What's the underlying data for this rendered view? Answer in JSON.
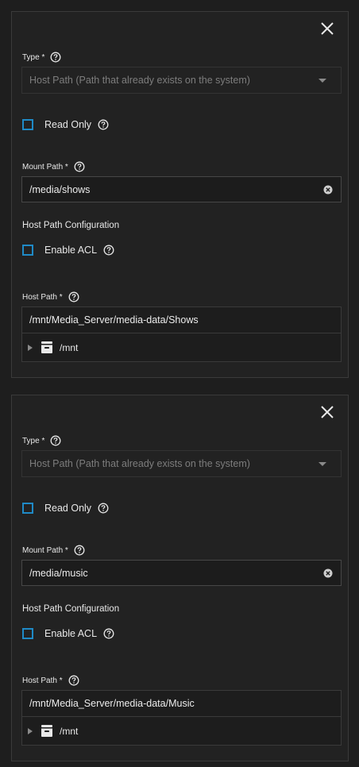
{
  "mounts": [
    {
      "type_label": "Type *",
      "type_value": "Host Path (Path that already exists on the system)",
      "read_only_label": "Read Only",
      "mount_path_label": "Mount Path *",
      "mount_path_value": "/media/shows",
      "host_path_config_title": "Host Path Configuration",
      "enable_acl_label": "Enable ACL",
      "host_path_label": "Host Path *",
      "host_path_value": "/mnt/Media_Server/media-data/Shows",
      "tree_root": "/mnt"
    },
    {
      "type_label": "Type *",
      "type_value": "Host Path (Path that already exists on the system)",
      "read_only_label": "Read Only",
      "mount_path_label": "Mount Path *",
      "mount_path_value": "/media/music",
      "host_path_config_title": "Host Path Configuration",
      "enable_acl_label": "Enable ACL",
      "host_path_label": "Host Path *",
      "host_path_value": "/mnt/Media_Server/media-data/Music",
      "tree_root": "/mnt"
    }
  ],
  "colors": {
    "checkbox_border": "#1f8ac6",
    "background": "#1e1e1e",
    "card": "#222222"
  },
  "icons": [
    "close-icon",
    "help-icon",
    "chevron-down-icon",
    "clear-icon",
    "tree-expand-icon",
    "dataset-folder-icon"
  ]
}
